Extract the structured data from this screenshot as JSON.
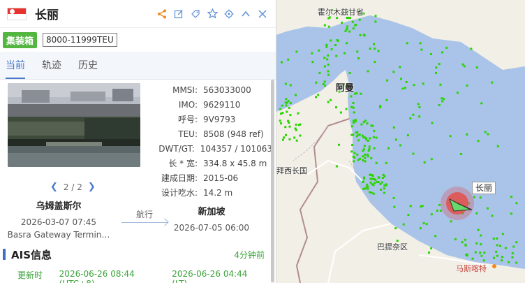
{
  "vessel": {
    "name": "长丽",
    "flag_country": "singapore-flag-icon",
    "type_tag": "集装箱",
    "capacity_tag": "8000-11999TEU"
  },
  "header_icons": [
    "share-icon",
    "edit-icon",
    "tag-icon",
    "star-icon",
    "locate-icon",
    "collapse-icon",
    "close-icon"
  ],
  "tabs": [
    {
      "label": "当前",
      "active": true
    },
    {
      "label": "轨迹",
      "active": false
    },
    {
      "label": "历史",
      "active": false
    }
  ],
  "photo_pager": {
    "text": "2 / 2"
  },
  "specs": [
    {
      "key": "MMSI:",
      "value": "563033000"
    },
    {
      "key": "IMO:",
      "value": "9629110"
    },
    {
      "key": "呼号:",
      "value": "9V9793"
    },
    {
      "key": "TEU:",
      "value": "8508 (948 ref)"
    },
    {
      "key": "DWT/GT:",
      "value": "104357 / 101063"
    },
    {
      "key": "长 * 宽:",
      "value": "334.8 x 45.8 m"
    },
    {
      "key": "建成日期:",
      "value": "2015-06"
    },
    {
      "key": "设计吃水:",
      "value": "14.2 m"
    }
  ],
  "route": {
    "origin": {
      "name": "乌姆盖斯尔",
      "time": "2026-03-07 07:45",
      "terminal": "Basra Gateway Termin…"
    },
    "status": "航行",
    "destination": {
      "name": "新加坡",
      "time": "2026-07-05 06:00"
    }
  },
  "ais": {
    "title": "AIS信息",
    "ago": "4分钟前",
    "update_label": "更新时间:",
    "update_utc": "2026-06-26 08:44 (UTC+8)",
    "update_lt": "2026-06-26 04:44 (LT)"
  },
  "map": {
    "labels": {
      "top": "霍尔木兹甘省",
      "oman": "阿曼",
      "bayeq": "拜西长国",
      "balochistan": "巴提奈区",
      "muscat": "马斯喀特"
    },
    "ship_tag": "长丽",
    "colors": {
      "sea": "#a9c4e8",
      "land": "#f2efe6",
      "ships": "#2ad400",
      "highlight": "#e0504a"
    }
  }
}
